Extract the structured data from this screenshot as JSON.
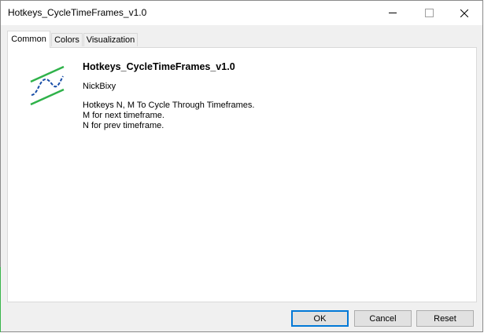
{
  "window": {
    "title": "Hotkeys_CycleTimeFrames_v1.0"
  },
  "tabs": [
    {
      "label": "Common",
      "active": true
    },
    {
      "label": "Colors",
      "active": false
    },
    {
      "label": "Visualization",
      "active": false
    }
  ],
  "program": {
    "name": "Hotkeys_CycleTimeFrames_v1.0",
    "author": "NickBixy",
    "description": [
      "Hotkeys N, M To Cycle Through Timeframes.",
      "M for next timeframe.",
      "N for prev timeframe."
    ],
    "icon": "indicator-wave-icon"
  },
  "buttons": {
    "ok": "OK",
    "cancel": "Cancel",
    "reset": "Reset"
  },
  "colors": {
    "accent": "#0078d7",
    "icon_green": "#2fb24a",
    "icon_blue": "#1a4fa8"
  }
}
